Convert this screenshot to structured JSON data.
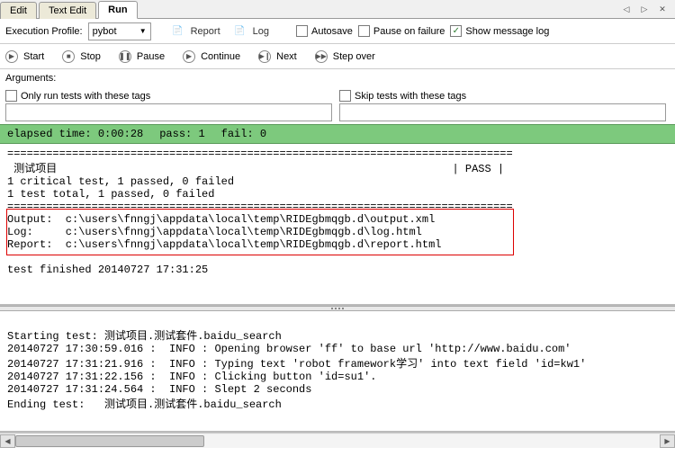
{
  "tabs": {
    "items": [
      "Edit",
      "Text Edit",
      "Run"
    ],
    "active_index": 2
  },
  "nav_icons": {
    "left": "◁",
    "right": "▷",
    "close": "✕"
  },
  "profile": {
    "label": "Execution Profile:",
    "value": "pybot"
  },
  "links": {
    "report": "Report",
    "log": "Log"
  },
  "checkboxes": {
    "autosave": {
      "label": "Autosave",
      "checked": false
    },
    "pause_failure": {
      "label": "Pause on failure",
      "checked": false
    },
    "show_msg_log": {
      "label": "Show message log",
      "checked": true
    }
  },
  "controls": {
    "start": "Start",
    "stop": "Stop",
    "pause": "Pause",
    "continue": "Continue",
    "next": "Next",
    "step_over": "Step over"
  },
  "args_label": "Arguments:",
  "tag_filters": {
    "only": {
      "label": "Only run tests with these tags",
      "checked": false,
      "value": ""
    },
    "skip": {
      "label": "Skip tests with these tags",
      "checked": false,
      "value": ""
    }
  },
  "status": {
    "elapsed": "elapsed time: 0:00:28",
    "pass": "pass: 1",
    "fail": "fail: 0"
  },
  "log_top": "==============================================================================\n 测试项目                                                             | PASS |\n1 critical test, 1 passed, 0 failed\n1 test total, 1 passed, 0 failed\n==============================================================================\nOutput:  c:\\users\\fnngj\\appdata\\local\\temp\\RIDEgbmqgb.d\\output.xml\nLog:     c:\\users\\fnngj\\appdata\\local\\temp\\RIDEgbmqgb.d\\log.html\nReport:  c:\\users\\fnngj\\appdata\\local\\temp\\RIDEgbmqgb.d\\report.html\n\ntest finished 20140727 17:31:25\n",
  "log_bottom": "\nStarting test: 测试项目.测试套件.baidu_search\n20140727 17:30:59.016 :  INFO : Opening browser 'ff' to base url 'http://www.baidu.com'\n20140727 17:31:21.916 :  INFO : Typing text 'robot framework学习' into text field 'id=kw1'\n20140727 17:31:22.156 :  INFO : Clicking button 'id=su1'.\n20140727 17:31:24.564 :  INFO : Slept 2 seconds\nEnding test:   测试项目.测试套件.baidu_search\n"
}
